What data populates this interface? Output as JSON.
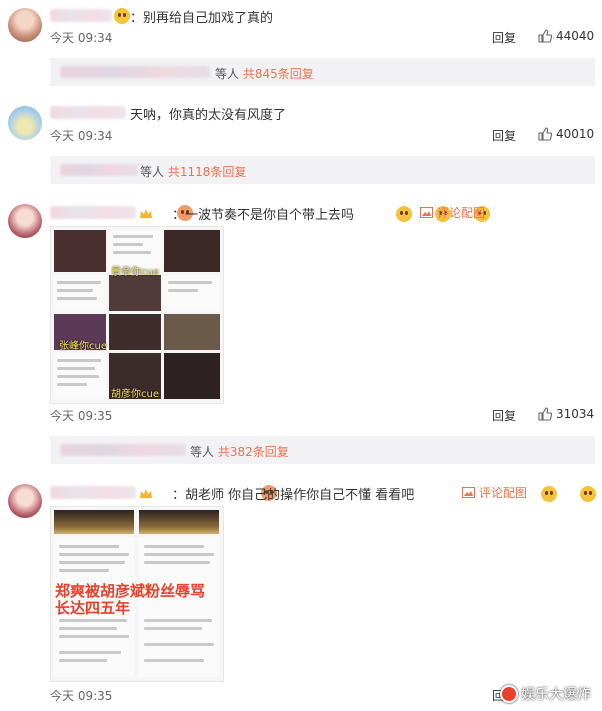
{
  "comments": [
    {
      "text": "：别再给自己加戏了真的",
      "time": "今天 09:34",
      "reply": "回复",
      "likes": "44040"
    },
    {
      "text": "天呐，你真的太没有风度了",
      "time": "今天 09:34",
      "reply": "回复",
      "likes": "40010"
    },
    {
      "text": "：一波节奏不是你自个带上去吗",
      "time": "今天 09:35",
      "reply": "回复",
      "likes": "31034",
      "image_link": "评论配图"
    },
    {
      "text": "：胡老师 你自己的操作你自己不懂 看看吧",
      "time": "今天 09:35",
      "reply": "回复",
      "image_link": "评论配图"
    }
  ],
  "subreplies": [
    {
      "prefix": "等人",
      "link": "共845条回复"
    },
    {
      "prefix": "等人",
      "link": "共1118条回复"
    },
    {
      "prefix": "等人",
      "link": "共382条回复"
    }
  ],
  "image_labels": {
    "img1_a": "景帝你cue",
    "img1_b": "张峰你cue",
    "img1_c": "胡彦你cue"
  },
  "image_overlay_text": "郑爽被胡彦斌粉丝辱骂长达四五年",
  "watermark": "娱乐大爆炸",
  "icons": [
    "thumb-up-icon",
    "picture-icon",
    "emoji-icon",
    "crown-icon"
  ],
  "colors": {
    "accent": "#eb7350",
    "subbox": "#f2f2f5"
  }
}
